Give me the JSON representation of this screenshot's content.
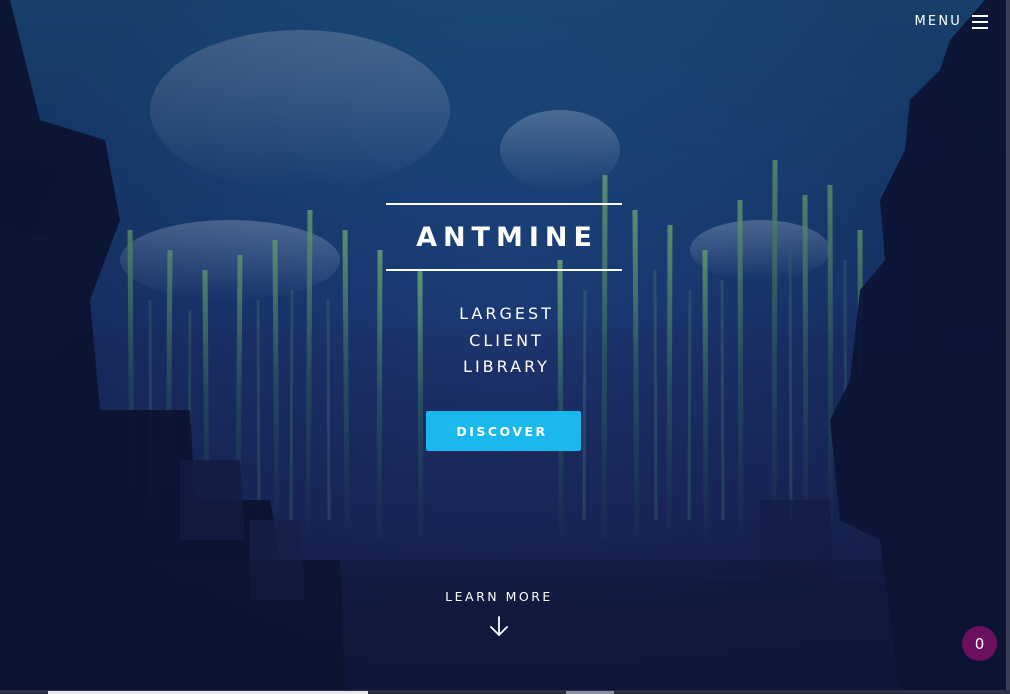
{
  "header": {
    "menu_label": "MENU",
    "menu_icon": "hamburger-icon"
  },
  "hero": {
    "brand": "ANTMINE",
    "tagline": [
      "LARGEST",
      "CLIENT",
      "LIBRARY"
    ],
    "cta_label": "DISCOVER"
  },
  "learn_more": {
    "label": "LEARN MORE",
    "icon": "arrow-down-icon"
  },
  "badge": {
    "count": "0"
  },
  "colors": {
    "accent": "#1bb8ee",
    "badge": "#6b0f5f",
    "text": "#ffffff"
  }
}
